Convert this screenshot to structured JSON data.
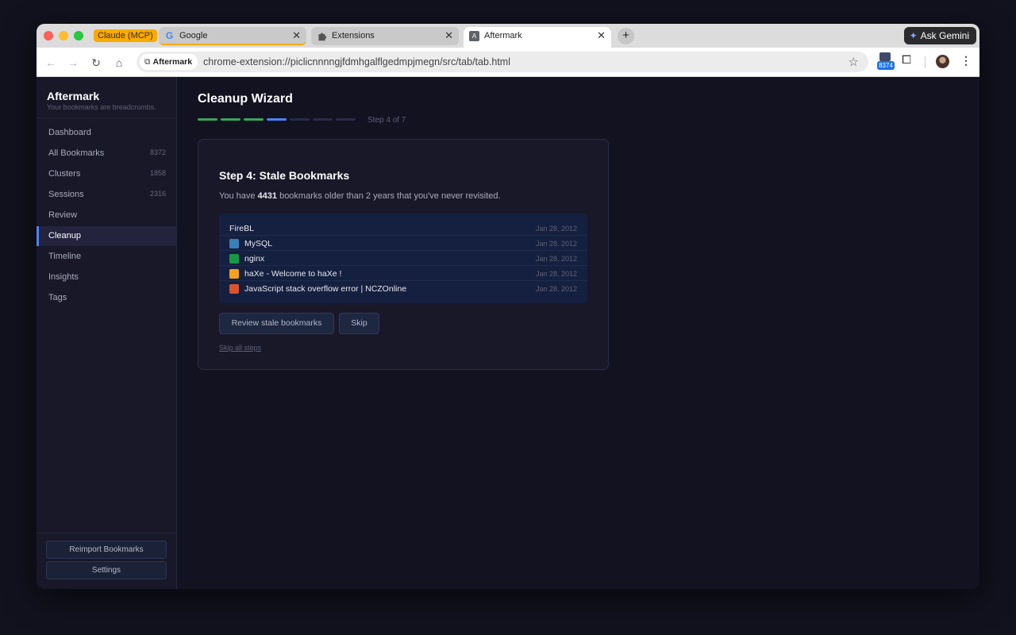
{
  "browser": {
    "tab_group": "Claude (MCP)",
    "tabs": [
      {
        "title": "Google",
        "icon": "google-icon"
      },
      {
        "title": "Extensions",
        "icon": "puzzle-icon"
      },
      {
        "title": "Aftermark",
        "icon": "aftermark-icon",
        "favicon_letter": "A"
      }
    ],
    "close_glyph": "✕",
    "new_tab": "+",
    "ask_gemini": "Ask Gemini",
    "site_chip": "Aftermark",
    "url": "chrome-extension://piclicnnnngjfdmhgalflgedmpjmegn/src/tab/tab.html",
    "extension_badge": "8374"
  },
  "sidebar": {
    "brand": "Aftermark",
    "tagline": "Your bookmarks are breadcrumbs.",
    "items": [
      {
        "label": "Dashboard",
        "count": ""
      },
      {
        "label": "All Bookmarks",
        "count": "8372"
      },
      {
        "label": "Clusters",
        "count": "1858"
      },
      {
        "label": "Sessions",
        "count": "2316"
      },
      {
        "label": "Review",
        "count": ""
      },
      {
        "label": "Cleanup",
        "count": "",
        "active": true
      },
      {
        "label": "Timeline",
        "count": ""
      },
      {
        "label": "Insights",
        "count": ""
      },
      {
        "label": "Tags",
        "count": ""
      }
    ],
    "reimport_label": "Reimport Bookmarks",
    "settings_label": "Settings"
  },
  "wizard": {
    "title": "Cleanup Wizard",
    "current_step": 4,
    "total_steps": 7,
    "step_label": "Step 4 of 7",
    "progress_colors": {
      "done": "#3ba55c",
      "current": "#4c82f7",
      "pending": "#2a2b45"
    },
    "card": {
      "title": "Step 4: Stale Bookmarks",
      "desc_prefix": "You have ",
      "stale_count": "4431",
      "desc_suffix": " bookmarks older than 2 years that you've never revisited.",
      "bookmarks": [
        {
          "title": "FireBL",
          "date": "Jan 28, 2012",
          "icon": "",
          "color": ""
        },
        {
          "title": "MySQL",
          "date": "Jan 28, 2012",
          "icon": "mysql-icon",
          "color": "#3a7fb5"
        },
        {
          "title": "nginx",
          "date": "Jan 28, 2012",
          "icon": "nginx-icon",
          "color": "#179945"
        },
        {
          "title": "haXe - Welcome to haXe !",
          "date": "Jan 28, 2012",
          "icon": "haxe-icon",
          "color": "#f5a11c"
        },
        {
          "title": "JavaScript stack overflow error | NCZOnline",
          "date": "Jan 28, 2012",
          "icon": "nczonline-icon",
          "color": "#d9532c"
        }
      ],
      "review_label": "Review stale bookmarks",
      "skip_label": "Skip",
      "skip_all_label": "Skip all steps"
    }
  }
}
